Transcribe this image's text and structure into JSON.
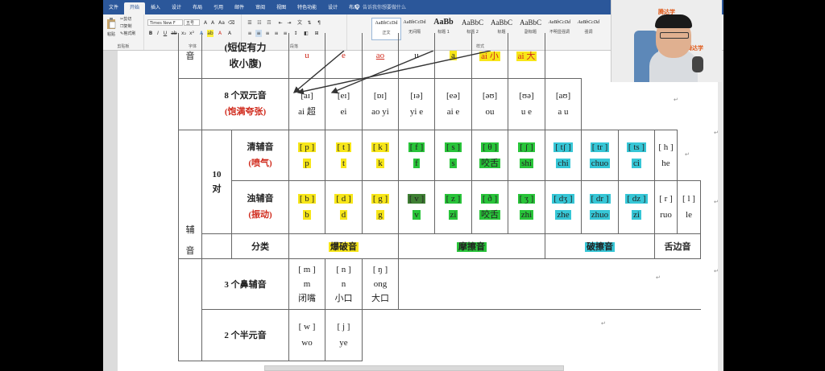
{
  "tabs": [
    "文件",
    "开始",
    "插入",
    "设计",
    "布局",
    "引用",
    "邮件",
    "审阅",
    "视图",
    "特色功能",
    "设计",
    "布局"
  ],
  "tell_me": "告诉我你想要做什么",
  "clipboard": {
    "paste": "粘贴",
    "cut": "剪切",
    "copy": "复制",
    "format_painter": "格式刷",
    "label": "剪贴板"
  },
  "font": {
    "name": "Times New F",
    "size": "五号",
    "label": "字体"
  },
  "paragraph_label": "段落",
  "styles_label": "样式",
  "styles": [
    {
      "preview": "AaBbCcDd",
      "name": "正文"
    },
    {
      "preview": "AaBbCcDd",
      "name": "无间隔"
    },
    {
      "preview": "AaBb",
      "name": "标题 1"
    },
    {
      "preview": "AaBbC",
      "name": "标题 2"
    },
    {
      "preview": "AaBbC",
      "name": "标题"
    },
    {
      "preview": "AaBbC",
      "name": "副标题"
    },
    {
      "preview": "AaBbCcDd",
      "name": "不明显强调"
    },
    {
      "preview": "AaBbCcDd",
      "name": "强调"
    },
    {
      "preview": "AaBbC",
      "name": "明显强调"
    }
  ],
  "webcam_logo": "腾达学",
  "table": {
    "monophthong_label": "音",
    "short_vowel_note_1": "(短促有力",
    "short_vowel_note_2": "收小腹)",
    "short_row": [
      "u",
      "e",
      "ao",
      "u",
      "a",
      "ai 小",
      "ai 大"
    ],
    "diphthong_title": "8 个双元音",
    "diphthong_note": "(饱满夸张)",
    "diphthongs": [
      {
        "ipa": "[aɪ]",
        "hint": "ai 超"
      },
      {
        "ipa": "[eɪ]",
        "hint": "ei"
      },
      {
        "ipa": "[ɒɪ]",
        "hint": "ao yi"
      },
      {
        "ipa": "[ɪə]",
        "hint": "yi e"
      },
      {
        "ipa": "[eə]",
        "hint": "ai e"
      },
      {
        "ipa": "[əʊ]",
        "hint": "ou"
      },
      {
        "ipa": "[ʊə]",
        "hint": "u e"
      },
      {
        "ipa": "[aʊ]",
        "hint": "a u"
      }
    ],
    "pairs_label": "10",
    "pairs_unit": "对",
    "consonant_label_1": "辅",
    "consonant_label_2": "音",
    "voiceless_title": "清辅音",
    "voiceless_note": "(喷气)",
    "voiceless": [
      {
        "ipa": "[ p ]",
        "hint": "p"
      },
      {
        "ipa": "[ t ]",
        "hint": "t"
      },
      {
        "ipa": "[ k ]",
        "hint": "k"
      },
      {
        "ipa": "[ f ]",
        "hint": "f"
      },
      {
        "ipa": "[ s ]",
        "hint": "s"
      },
      {
        "ipa": "[ θ ]",
        "hint": "咬舌"
      },
      {
        "ipa": "[ ʃ ]",
        "hint": "shi"
      },
      {
        "ipa": "[ tʃ ]",
        "hint": "chi"
      },
      {
        "ipa": "[ tr ]",
        "hint": "chuo"
      },
      {
        "ipa": "[ ts ]",
        "hint": "ci"
      },
      {
        "ipa": "[ h ]",
        "hint": "he"
      }
    ],
    "voiced_title": "浊辅音",
    "voiced_note": "(振动)",
    "voiced": [
      {
        "ipa": "[ b ]",
        "hint": "b"
      },
      {
        "ipa": "[ d ]",
        "hint": "d"
      },
      {
        "ipa": "[ g ]",
        "hint": "g"
      },
      {
        "ipa": "[ v ]",
        "hint": "v"
      },
      {
        "ipa": "[ z ]",
        "hint": "zi"
      },
      {
        "ipa": "[ ð ]",
        "hint": "咬舌"
      },
      {
        "ipa": "[ ʒ ]",
        "hint": "zhi"
      },
      {
        "ipa": "[ dʒ ]",
        "hint": "zhe"
      },
      {
        "ipa": "[ dr ]",
        "hint": "zhuo"
      },
      {
        "ipa": "[ dz ]",
        "hint": "zi"
      },
      {
        "ipa": "[ r ]",
        "hint": "ruo"
      },
      {
        "ipa": "[ l ]",
        "hint": "le"
      }
    ],
    "class_label": "分类",
    "class_plosive": "爆破音",
    "class_fricative": "摩擦音",
    "class_affricate": "破擦音",
    "class_lateral": "舌边音",
    "nasal_title": "3 个鼻辅音",
    "nasals": [
      {
        "ipa": "[ m ]",
        "hint1": "m",
        "hint2": "闭嘴"
      },
      {
        "ipa": "[ n ]",
        "hint1": "n",
        "hint2": "小口"
      },
      {
        "ipa": "[ ŋ ]",
        "hint1": "ong",
        "hint2": "大口"
      }
    ],
    "semi_title": "2 个半元音",
    "semis": [
      {
        "ipa": "[ w ]",
        "hint": "wo"
      },
      {
        "ipa": "[ j ]",
        "hint": "ye"
      }
    ]
  }
}
